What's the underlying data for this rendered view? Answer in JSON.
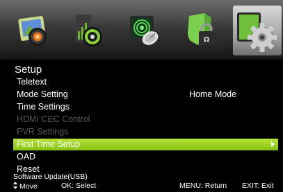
{
  "tabs": [
    {
      "name": "picture-tab",
      "icon": "picture-icon",
      "active": false
    },
    {
      "name": "sound-tab",
      "icon": "speaker-icon",
      "active": false
    },
    {
      "name": "channel-tab",
      "icon": "satellite-dish-icon",
      "active": false
    },
    {
      "name": "lock-tab",
      "icon": "shield-lock-icon",
      "active": false
    },
    {
      "name": "setup-tab",
      "icon": "gear-icon",
      "active": true
    }
  ],
  "menu": {
    "title": "Setup",
    "items": [
      {
        "label": "Teletext",
        "value": "",
        "state": "normal"
      },
      {
        "label": "Mode Setting",
        "value": "Home Mode",
        "state": "normal"
      },
      {
        "label": "Time Settings",
        "value": "",
        "state": "normal"
      },
      {
        "label": "HDMI CEC Control",
        "value": "",
        "state": "disabled"
      },
      {
        "label": "PVR Settings",
        "value": "",
        "state": "disabled"
      },
      {
        "label": "First Time Setup",
        "value": "",
        "state": "selected"
      },
      {
        "label": "OAD",
        "value": "",
        "state": "normal"
      },
      {
        "label": "Reset",
        "value": "",
        "state": "normal"
      }
    ]
  },
  "footer": {
    "software_update": "Software Update(USB)",
    "move": "Move",
    "ok": "OK: Select",
    "menu": "MENU: Return",
    "exit": "EXIT: Exit"
  },
  "colors": {
    "highlight": "#9ed42a",
    "disabled_text": "#5a5a5a",
    "background": "#000000"
  }
}
